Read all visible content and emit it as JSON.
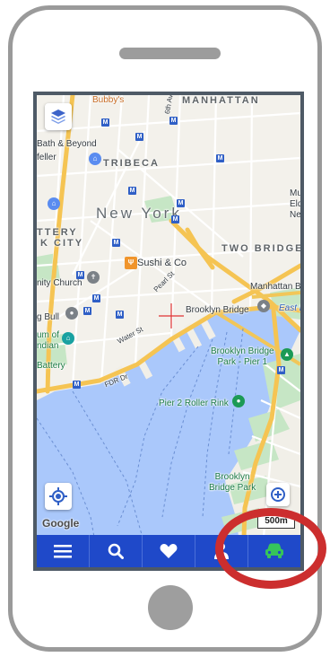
{
  "map": {
    "area_title": "New York",
    "labels": {
      "bubbys": "Bubby's",
      "manhattan": "MANHATTAN",
      "bath_beyond": "Bath & Beyond",
      "feller": "feller",
      "tribeca": "TRIBECA",
      "ttery": "TTERY",
      "k_city": "K CITY",
      "sushi": "Sushi & Co",
      "two_bridges": "TWO BRIDGES",
      "mu": "Mu",
      "eld": "Eld",
      "ne": "Ne",
      "nity_church": "nity Church",
      "g_bull": "g Bull",
      "pearl_st": "Pearl St",
      "water_st": "Water St",
      "fdr_dr": "FDR Dr",
      "brooklyn_bridge": "Brooklyn Bridge",
      "manhattan_b": "Manhattan B",
      "east_r": "East R",
      "um_of": "um of",
      "ndian": "ndian",
      "battery": "Battery",
      "bb_park": "Brooklyn Bridge\nPark - Pier 1",
      "pier2": "Pier 2 Roller Rink",
      "bb_park2": "Brooklyn\nBridge Park",
      "six_ave": "6th Ave"
    },
    "metro_symbol": "M",
    "google_logo": "Google",
    "scale": "500m"
  },
  "colors": {
    "water": "#aac8fb",
    "land": "#f3f1eb",
    "park": "#c6e6c5",
    "highway": "#f5c453",
    "nav_bar": "#1f49c9",
    "annotation": "#cc2e2e"
  },
  "icons": {
    "layers": "layers-icon",
    "locate": "crosshair-target-icon",
    "zoom": "zoom-plus-icon",
    "nav": [
      "menu-icon",
      "search-icon",
      "heart-icon",
      "person-icon",
      "car-icon"
    ]
  }
}
